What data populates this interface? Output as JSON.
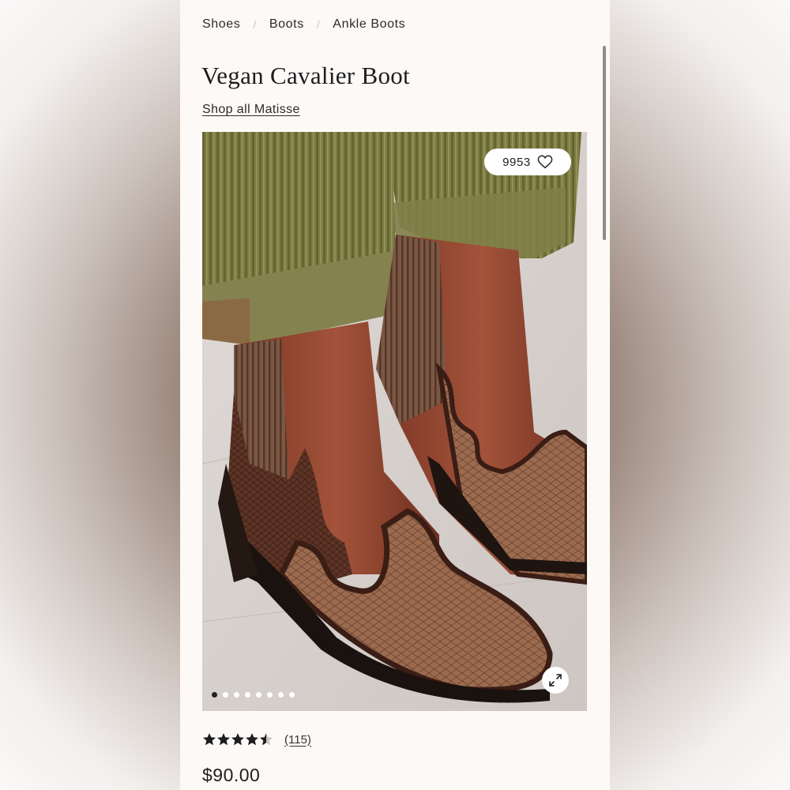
{
  "breadcrumb": {
    "items": [
      "Shoes",
      "Boots",
      "Ankle Boots"
    ],
    "separator": "/"
  },
  "product": {
    "title": "Vegan Cavalier Boot",
    "shop_link": "Shop all Matisse",
    "favorites_count": "9953",
    "rating": 4.5,
    "reviews": "(115)",
    "price": "$90.00"
  },
  "gallery": {
    "image_count": 8,
    "active_index": 0
  },
  "icons": {
    "favorite": "heart-icon",
    "expand": "expand-icon",
    "rating": "star-icon"
  },
  "colors": {
    "page_bg": "#fcf9f7",
    "text": "#1d1d1d",
    "leather": "#8a4a35",
    "croc": "#9b6a4e",
    "corduroy": "#7b7a42"
  }
}
